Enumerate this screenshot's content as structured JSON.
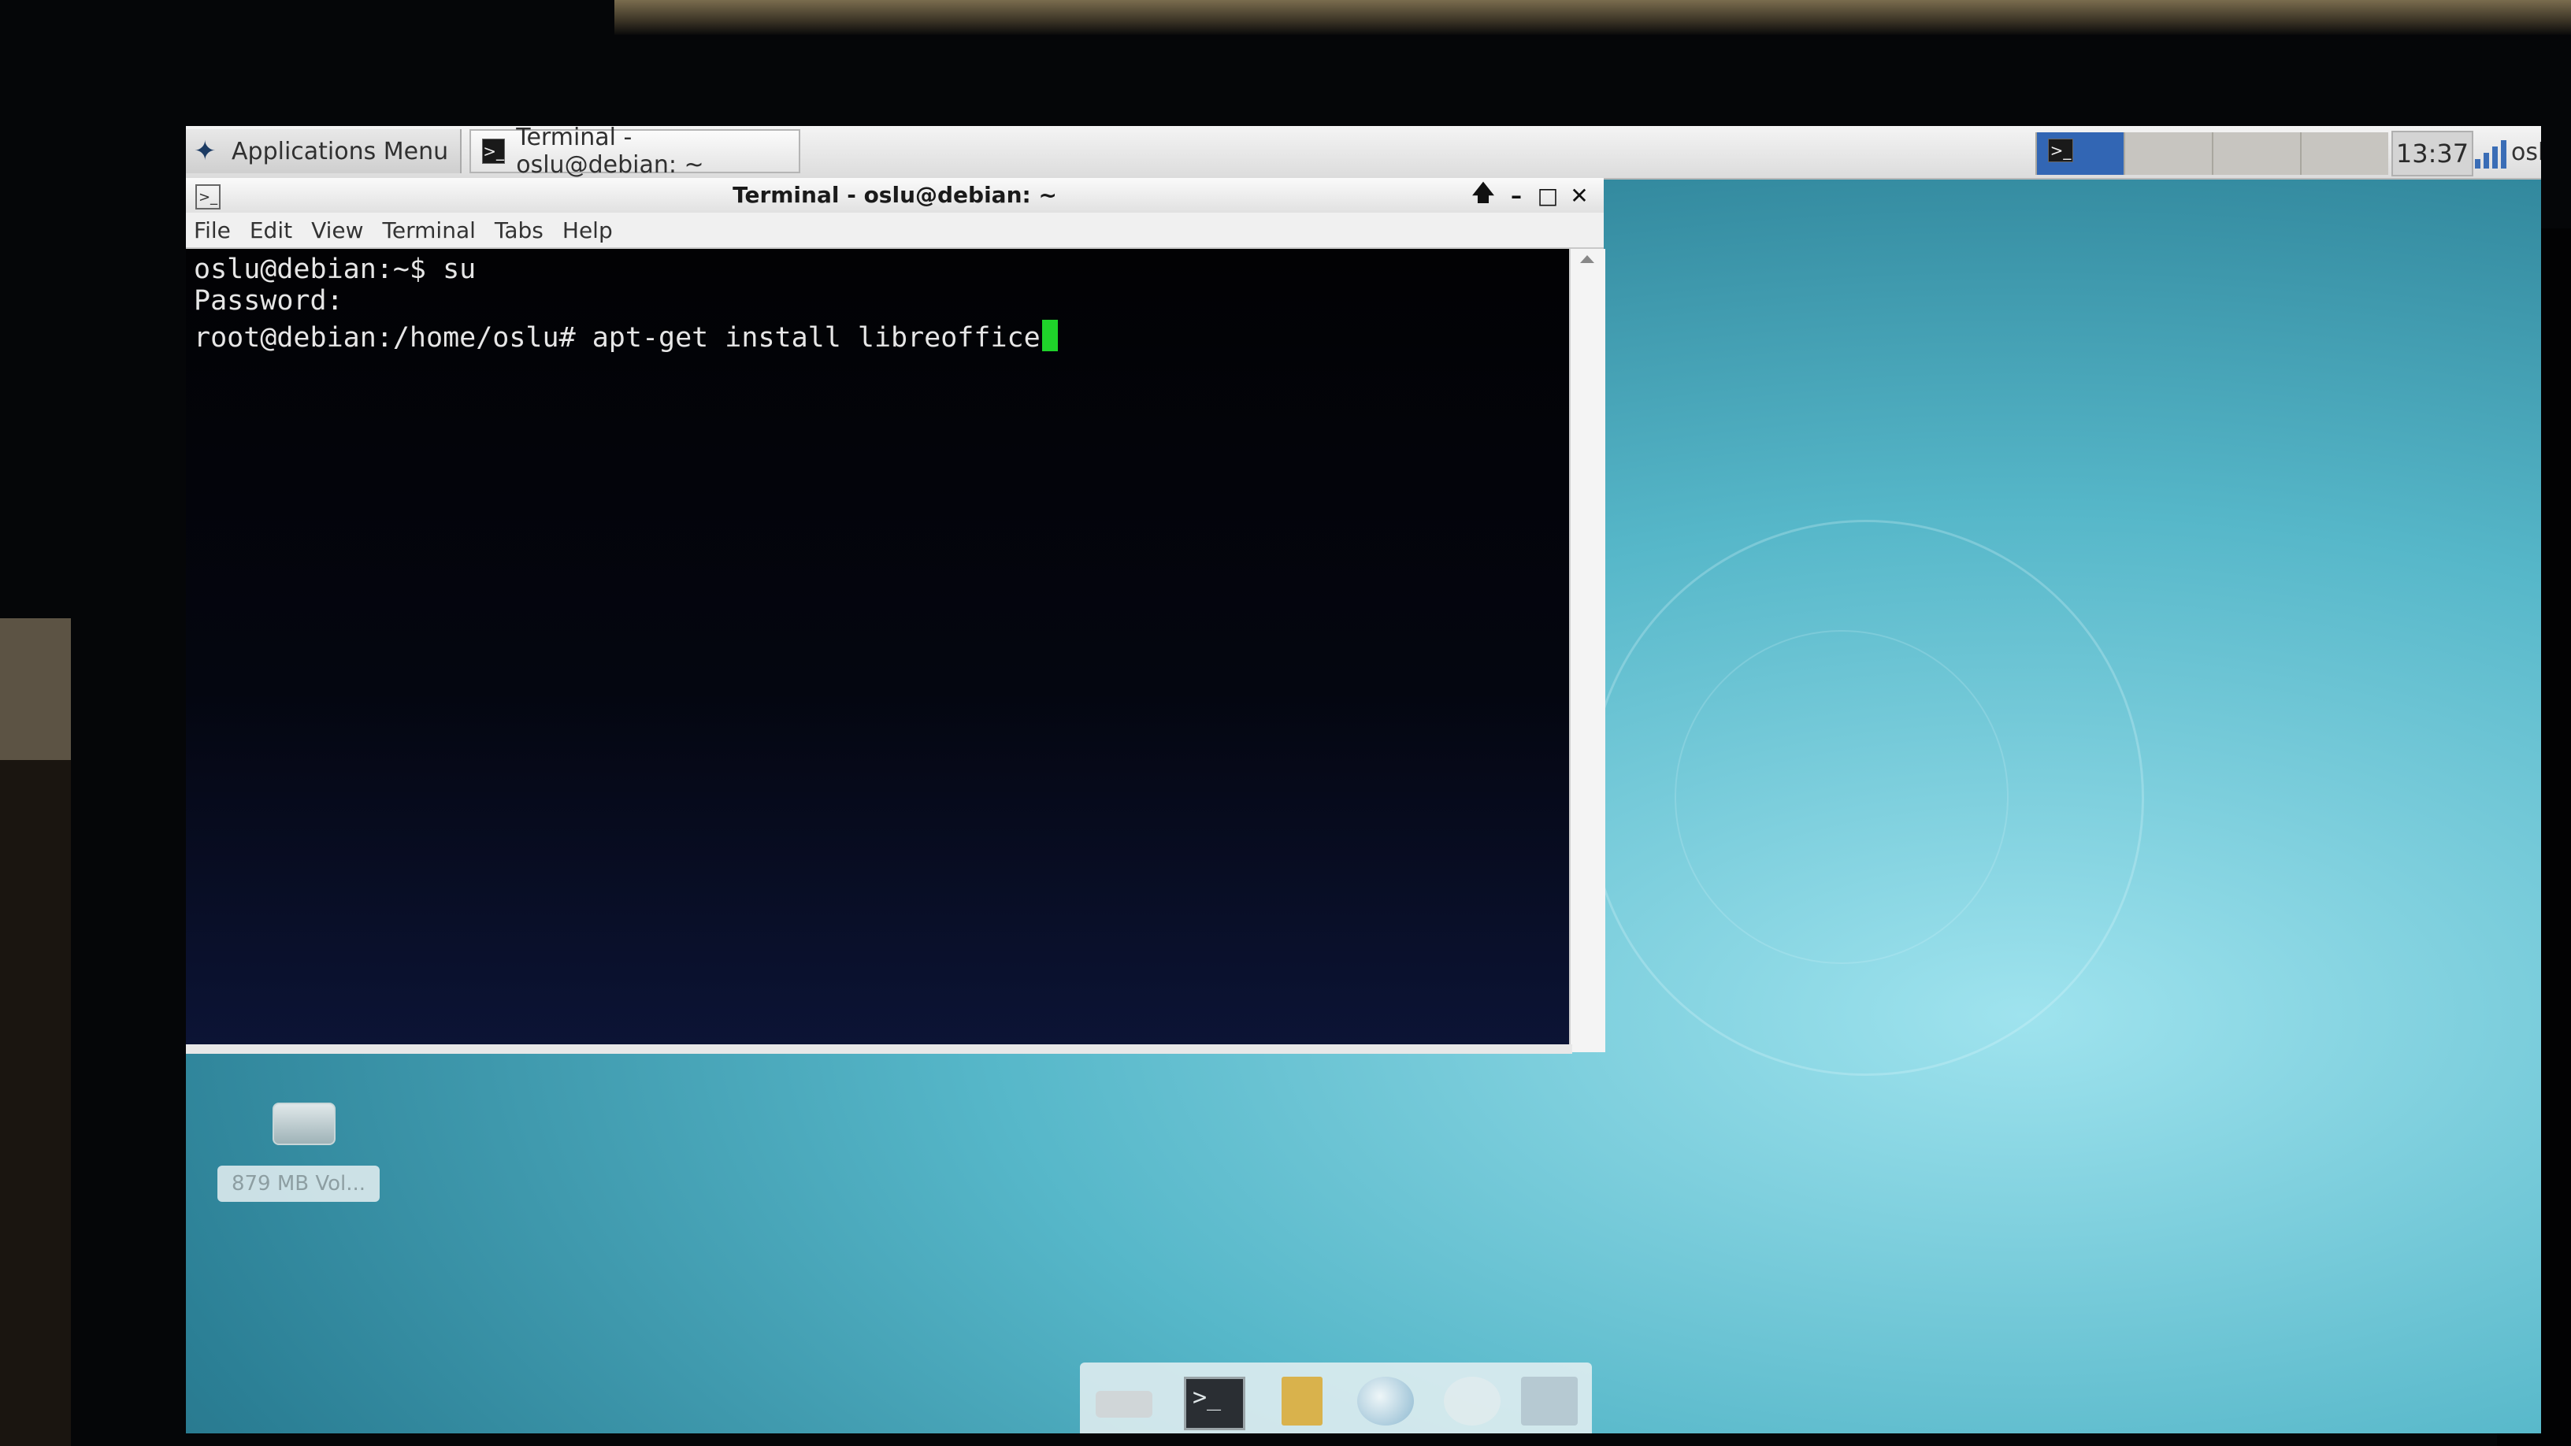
{
  "panel": {
    "apps_menu_label": "Applications Menu",
    "apps_menu_icon": "xfce-mouse-icon",
    "task_label": "Terminal - oslu@debian: ~",
    "task_icon": "terminal-icon",
    "clock": "13:37",
    "user": "oslu",
    "network_icon": "signal-bars-icon"
  },
  "window": {
    "title": "Terminal - oslu@debian: ~",
    "controls": {
      "up": "🡅",
      "minimize": "–",
      "maximize": "□",
      "close": "✕"
    },
    "menu": [
      "File",
      "Edit",
      "View",
      "Terminal",
      "Tabs",
      "Help"
    ],
    "lines": [
      "oslu@debian:~$ su",
      "Password:",
      "root@debian:/home/oslu# apt-get install libreoffice"
    ],
    "cursor_color": "#1fd32a"
  },
  "desktop": {
    "icon_label": "879 MB Vol...",
    "icon_name": "drive-icon"
  },
  "dock": {
    "items": [
      "drive-icon",
      "terminal-icon",
      "file-manager-icon",
      "browser-icon",
      "search-icon",
      "folder-icon"
    ]
  }
}
